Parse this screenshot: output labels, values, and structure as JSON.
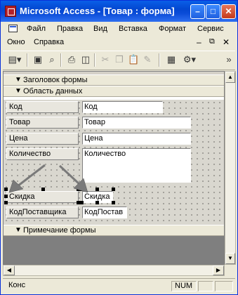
{
  "window": {
    "title": "Microsoft Access - [Товар : форма]"
  },
  "menu": {
    "row1": [
      "Файл",
      "Правка",
      "Вид",
      "Вставка",
      "Формат",
      "Сервис"
    ],
    "row2": [
      "Окно",
      "Справка"
    ]
  },
  "toolbar": {
    "icons": [
      "form-view-icon",
      "save-icon",
      "search-icon",
      "print-icon",
      "print-preview-icon",
      "cut-icon",
      "copy-icon",
      "paste-icon",
      "format-painter-icon",
      "properties-icon",
      "build-icon"
    ]
  },
  "sections": {
    "header": "Заголовок формы",
    "detail": "Область данных",
    "footer": "Примечание формы"
  },
  "form": {
    "rows": [
      {
        "label": "Код",
        "field": "Код"
      },
      {
        "label": "Товар",
        "field": "Товар"
      },
      {
        "label": "Цена",
        "field": "Цена"
      },
      {
        "label": "Количество",
        "field": "Количество"
      },
      {
        "label": "Скидка",
        "field": "Скидка"
      },
      {
        "label": "КодПоставщика",
        "field": "КодПостав"
      }
    ]
  },
  "status": {
    "left": "Конс",
    "num": "NUM"
  },
  "colors": {
    "titlebar": "#0a4cd8",
    "arrow": "#7a7a7a"
  }
}
